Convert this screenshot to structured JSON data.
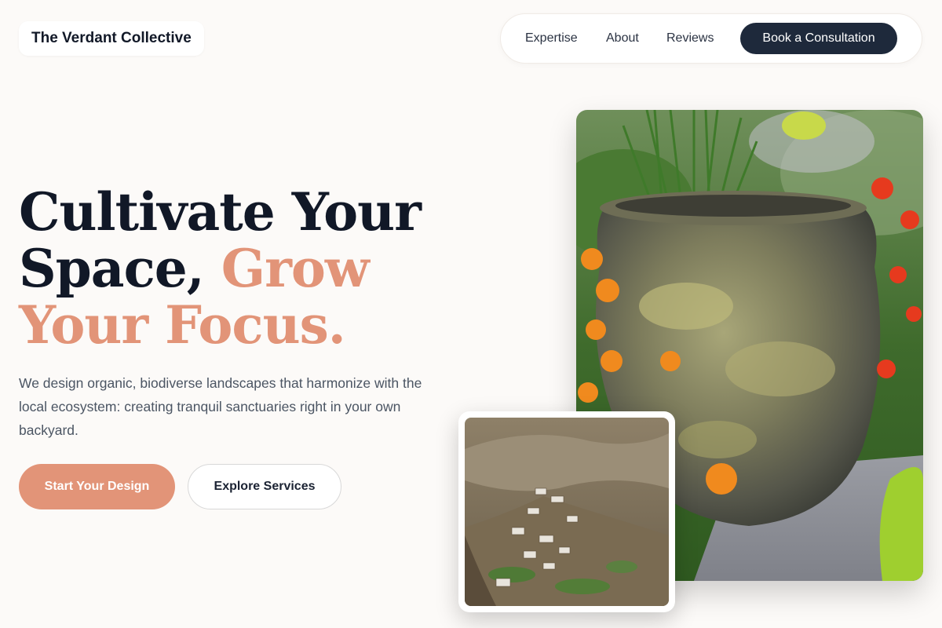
{
  "header": {
    "brand": "The Verdant Collective",
    "nav": [
      "Expertise",
      "About",
      "Reviews"
    ],
    "cta_label": "Book a Consultation"
  },
  "hero": {
    "headline_dark": "Cultivate Your Space,",
    "headline_accent": "Grow Your Focus.",
    "subtext": "We design organic, biodiverse landscapes that harmonize with the local ecosystem: creating tranquil sanctuaries right in your own backyard.",
    "primary_button": "Start Your Design",
    "secondary_button": "Explore Services"
  },
  "images": {
    "main": "garden-urn-with-marigolds-photo",
    "inset": "mountain-village-photo"
  },
  "colors": {
    "accent": "#e29478",
    "dark": "#1e293b",
    "background": "#fcfaf8"
  }
}
